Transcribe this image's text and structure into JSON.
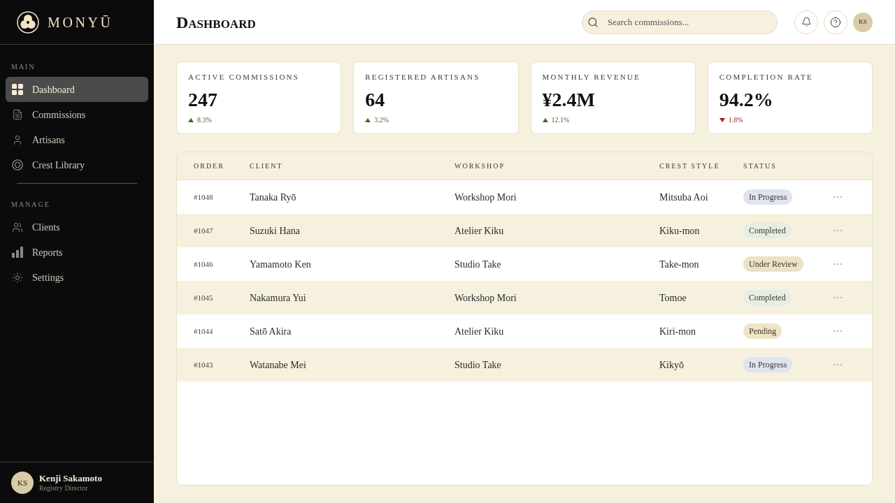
{
  "sidebar": {
    "brand": "MONYŪ",
    "sections": [
      {
        "title": "MAIN",
        "items": [
          {
            "label": "Dashboard",
            "selected": true
          },
          {
            "label": "Commissions",
            "selected": false
          },
          {
            "label": "Artisans",
            "selected": false
          },
          {
            "label": "Crest Library",
            "selected": false
          }
        ]
      },
      {
        "title": "MANAGE",
        "items": [
          {
            "label": "Clients",
            "selected": false
          },
          {
            "label": "Reports",
            "selected": false
          },
          {
            "label": "Settings",
            "selected": false
          }
        ]
      }
    ],
    "user": {
      "initials": "KS",
      "name": "Kenji Sakamoto",
      "role": "Registry Director"
    }
  },
  "header": {
    "title": "Dashboard",
    "search": {
      "placeholder": "Search commissions..."
    },
    "avatar_initials": "KS"
  },
  "stats": [
    {
      "label": "ACTIVE COMMISSIONS",
      "value": "247",
      "change": "8.3%",
      "rising": true
    },
    {
      "label": "REGISTERED ARTISANS",
      "value": "64",
      "change": "3.2%",
      "rising": true
    },
    {
      "label": "MONTHLY REVENUE",
      "value": "¥2.4M",
      "change": "12.1%",
      "rising": true
    },
    {
      "label": "COMPLETION RATE",
      "value": "94.2%",
      "change": "1.8%",
      "rising": false
    }
  ],
  "table": {
    "columns": [
      "ORDER",
      "CLIENT",
      "WORKSHOP",
      "CREST STYLE",
      "STATUS"
    ],
    "rows": [
      {
        "order": "#1048",
        "client": "Tanaka Ryō",
        "workshop": "Workshop Mori",
        "crest_style": "Mitsuba Aoi",
        "status": {
          "label": "In Progress",
          "color": "#dfe4ee"
        }
      },
      {
        "order": "#1047",
        "client": "Suzuki Hana",
        "workshop": "Atelier Kiku",
        "crest_style": "Kiku-mon",
        "status": {
          "label": "Completed",
          "color": "#e5eee4"
        }
      },
      {
        "order": "#1046",
        "client": "Yamamoto Ken",
        "workshop": "Studio Take",
        "crest_style": "Take-mon",
        "status": {
          "label": "Under Review",
          "color": "#ece1c4"
        }
      },
      {
        "order": "#1045",
        "client": "Nakamura Yui",
        "workshop": "Workshop Mori",
        "crest_style": "Tomoe",
        "status": {
          "label": "Completed",
          "color": "#e5eee4"
        }
      },
      {
        "order": "#1044",
        "client": "Satō Akira",
        "workshop": "Atelier Kiku",
        "crest_style": "Kiri-mon",
        "status": {
          "label": "Pending",
          "color": "#f0e4c6"
        }
      },
      {
        "order": "#1043",
        "client": "Watanabe Mei",
        "workshop": "Studio Take",
        "crest_style": "Kikyō",
        "status": {
          "label": "In Progress",
          "color": "#dfe4ee"
        }
      }
    ]
  }
}
